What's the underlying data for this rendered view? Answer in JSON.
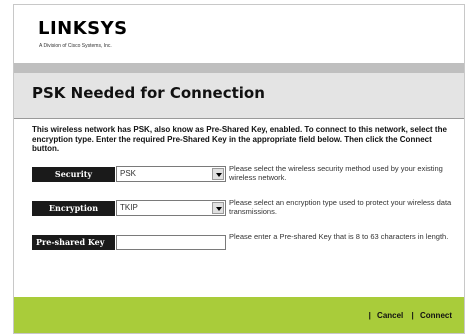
{
  "brand": {
    "logo": "LINKSYS",
    "tagline": "A Division of Cisco Systems, Inc."
  },
  "page": {
    "title": "PSK Needed for Connection",
    "intro": "This wireless network has PSK, also know as Pre-Shared Key, enabled. To connect to this network, select the encryption type. Enter the required Pre-Shared Key in the appropriate field below. Then click the Connect button."
  },
  "form": {
    "security": {
      "label": "Security",
      "value": "PSK",
      "help": "Please select the wireless security method used by your existing wireless network."
    },
    "encryption": {
      "label": "Encryption",
      "value": "TKIP",
      "help": "Please select an encryption type used to protect your wireless data transmissions."
    },
    "psk": {
      "label": "Pre-shared Key",
      "value": "",
      "help": "Please enter a Pre-shared Key that is 8 to 63 characters in length."
    }
  },
  "footer": {
    "cancel_label": "Cancel",
    "connect_label": "Connect",
    "separator": "|"
  },
  "colors": {
    "footer_green": "#a9cc3a",
    "label_bg": "#1a1a1a",
    "title_bar": "#e4e4e4"
  }
}
